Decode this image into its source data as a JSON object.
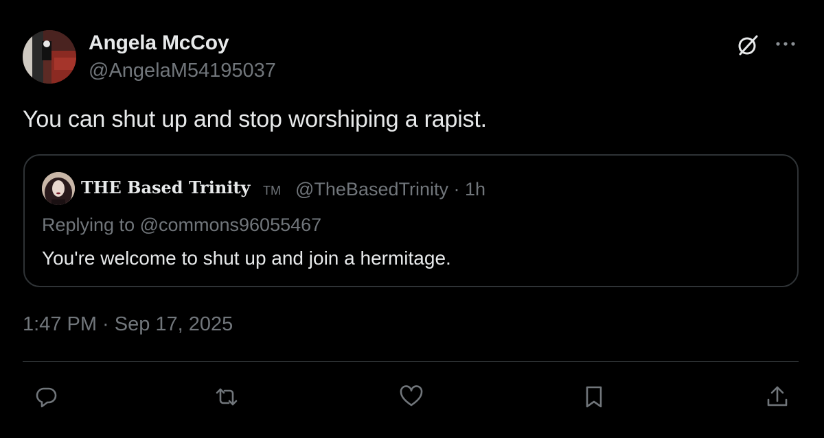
{
  "author": {
    "name": "Angela McCoy",
    "handle": "@AngelaM54195037"
  },
  "header_icons": [
    "grok-icon",
    "more-icon"
  ],
  "tweet": {
    "text": "You can shut up and stop worshiping a rapist.",
    "timestamp": "1:47 PM · Sep 17, 2025"
  },
  "quoted_tweet": {
    "name": "THE Based Trinity",
    "trademark": "TM",
    "handle_time": "@TheBasedTrinity · 1h",
    "replying_to": "Replying to @commons96055467",
    "text": "You're welcome to shut up and join a hermitage."
  },
  "actions": [
    "reply-icon",
    "repost-icon",
    "like-icon",
    "bookmark-icon",
    "share-icon"
  ],
  "colors": {
    "background": "#000000",
    "primary_text": "#e7e9ea",
    "secondary_text": "#71767b",
    "border": "#2f3336"
  }
}
